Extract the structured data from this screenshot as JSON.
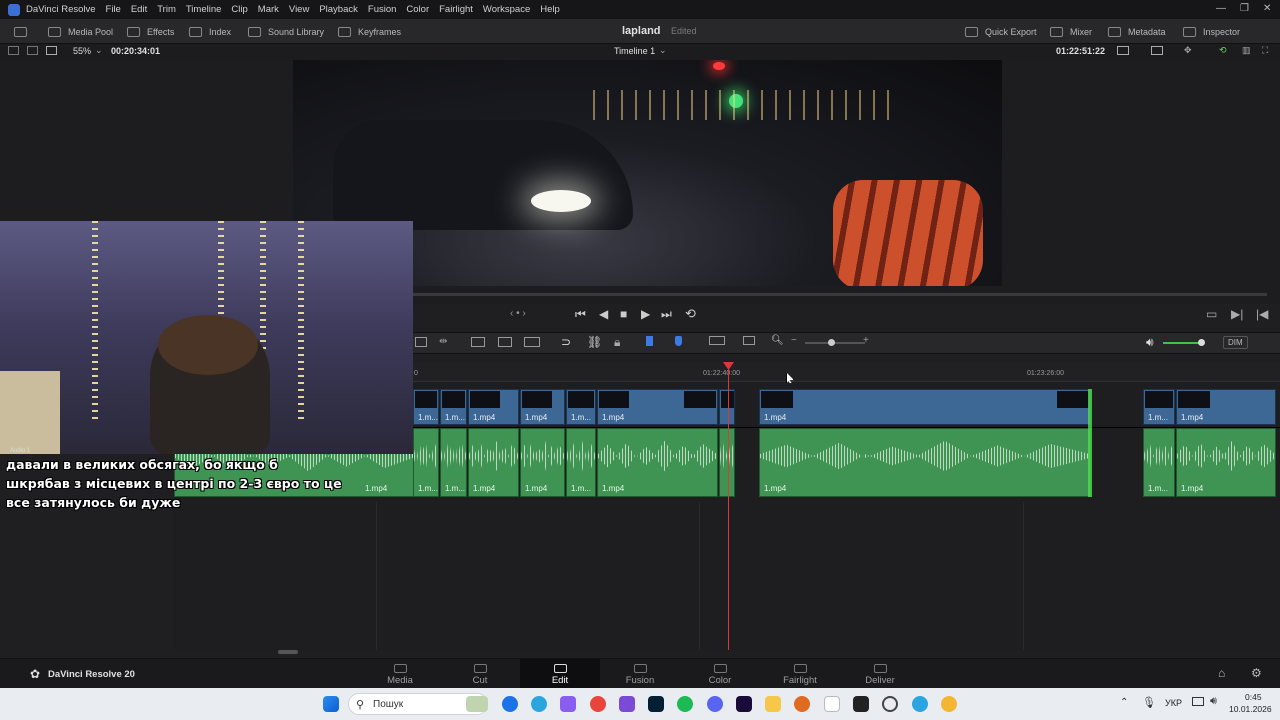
{
  "menubar": {
    "app_name": "DaVinci Resolve",
    "items": [
      "File",
      "Edit",
      "Trim",
      "Timeline",
      "Clip",
      "Mark",
      "View",
      "Playback",
      "Fusion",
      "Color",
      "Fairlight",
      "Workspace",
      "Help"
    ]
  },
  "toolbar": {
    "media_pool": "Media Pool",
    "effects": "Effects",
    "index": "Index",
    "sound_library": "Sound Library",
    "keyframes": "Keyframes",
    "project_title": "lapland",
    "project_status": "Edited",
    "quick_export": "Quick Export",
    "mixer": "Mixer",
    "metadata": "Metadata",
    "inspector": "Inspector"
  },
  "viewer": {
    "zoom": "55%",
    "source_timecode": "00:20:34:01",
    "timeline_name": "Timeline 1",
    "record_timecode": "01:22:51:22"
  },
  "timeline_tools": {
    "dim_label": "DIM"
  },
  "ruler": {
    "tick_start": "0",
    "tick_mid": "01:22:40:00",
    "tick_right": "01:23:26:00"
  },
  "tracks": {
    "clip_name": "1.mp4",
    "clip_name_short": "1.m...",
    "audio_track_label": "Audio 1"
  },
  "subtitle": {
    "line1": "давали в великих обсягах, бо якщо б",
    "line2": "шкрябав з місцевих в центрі по 2-3 євро то це",
    "line3": "все затянулось би дуже"
  },
  "pagebar": {
    "brand": "DaVinci Resolve 20",
    "tabs": [
      "Media",
      "Cut",
      "Edit",
      "Fusion",
      "Color",
      "Fairlight",
      "Deliver"
    ],
    "active_tab": "Edit"
  },
  "taskbar": {
    "search_placeholder": "Пошук",
    "language": "УКР",
    "time": "0:45",
    "date": "10.01.2026"
  },
  "colors": {
    "video_clip": "#3d6794",
    "audio_clip": "#3f9453",
    "playhead": "#e0353a",
    "active_tab_bg": "#0e0e10"
  }
}
